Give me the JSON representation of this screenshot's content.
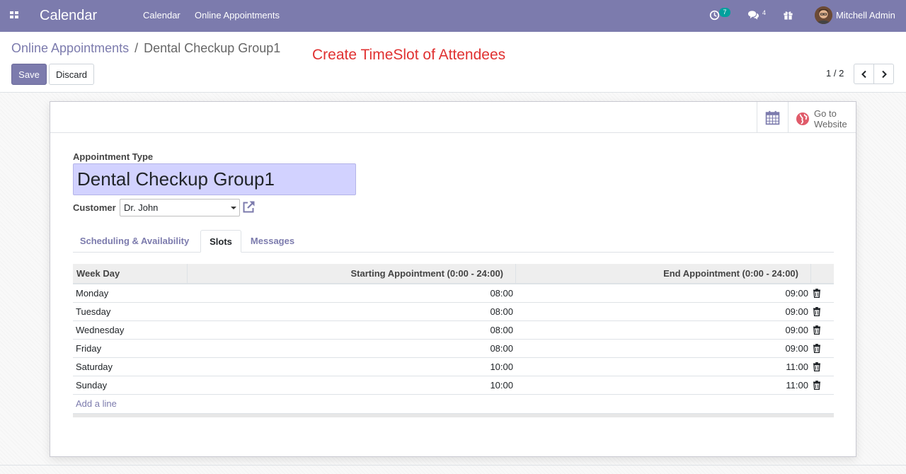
{
  "navbar": {
    "app_title": "Calendar",
    "menu": [
      "Calendar",
      "Online Appointments"
    ],
    "activity_count": "7",
    "messages_count": "4",
    "user_name": "Mitchell Admin"
  },
  "control_panel": {
    "breadcrumb_parent": "Online Appointments",
    "breadcrumb_separator": "/",
    "breadcrumb_current": "Dental Checkup Group1",
    "annotation": "Create TimeSlot of Attendees",
    "save_label": "Save",
    "discard_label": "Discard",
    "pager": "1 / 2"
  },
  "smart_buttons": {
    "website_line1": "Go to",
    "website_line2": "Website"
  },
  "form": {
    "appointment_type_label": "Appointment Type",
    "appointment_type_value": "Dental Checkup Group1",
    "customer_label": "Customer",
    "customer_value": "Dr. John"
  },
  "tabs": [
    "Scheduling & Availability",
    "Slots",
    "Messages"
  ],
  "active_tab": "Slots",
  "slots_table": {
    "headers": [
      "Week Day",
      "Starting Appointment (0:00 - 24:00)",
      "End Appointment (0:00 - 24:00)"
    ],
    "rows": [
      {
        "day": "Monday",
        "start": "08:00",
        "end": "09:00"
      },
      {
        "day": "Tuesday",
        "start": "08:00",
        "end": "09:00"
      },
      {
        "day": "Wednesday",
        "start": "08:00",
        "end": "09:00"
      },
      {
        "day": "Friday",
        "start": "08:00",
        "end": "09:00"
      },
      {
        "day": "Saturday",
        "start": "10:00",
        "end": "11:00"
      },
      {
        "day": "Sunday",
        "start": "10:00",
        "end": "11:00"
      }
    ],
    "add_line_label": "Add a line"
  },
  "colors": {
    "brand": "#7c7bad",
    "annotation": "#e03131",
    "badge": "#00a09d",
    "required_field": "#d2d2ff"
  }
}
